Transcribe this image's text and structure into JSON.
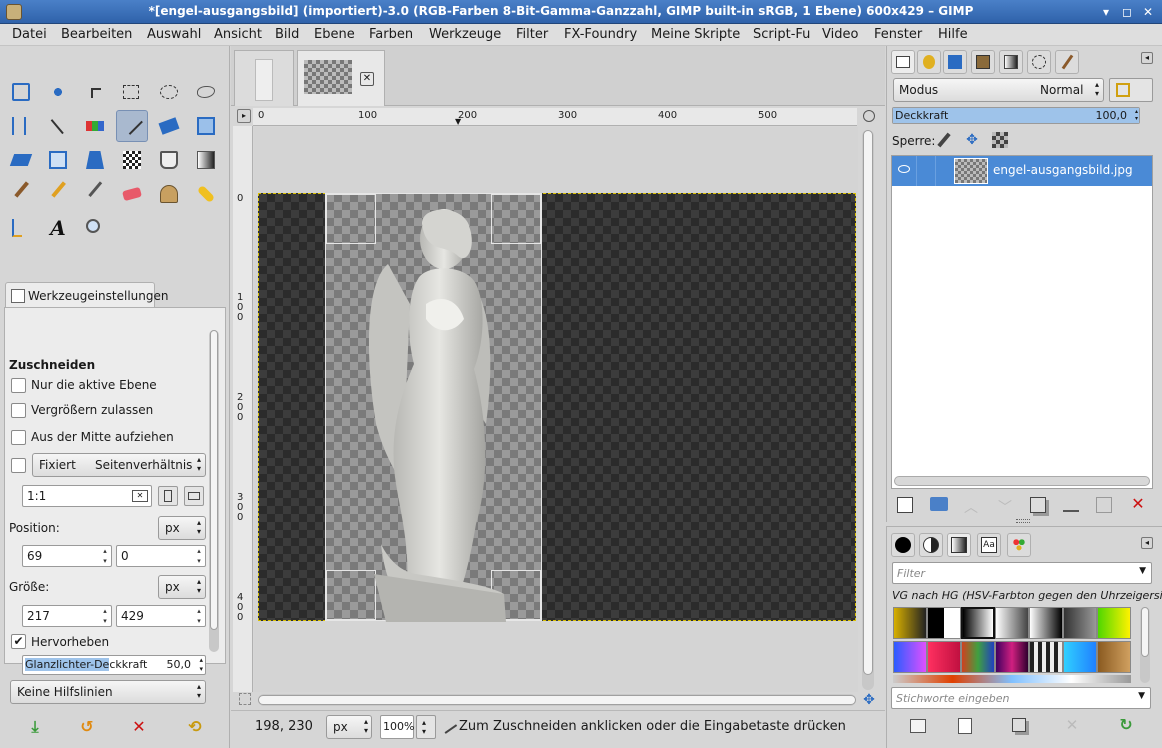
{
  "window": {
    "title": "*[engel-ausgangsbild] (importiert)-3.0 (RGB-Farben 8-Bit-Gamma-Ganzzahl, GIMP built-in sRGB, 1 Ebene) 600x429 – GIMP",
    "minimize": "▾",
    "maximize": "◻",
    "close": "✕"
  },
  "menu": [
    "Datei",
    "Bearbeiten",
    "Auswahl",
    "Ansicht",
    "Bild",
    "Ebene",
    "Farben",
    "Werkzeuge",
    "Filter",
    "FX-Foundry",
    "Meine Skripte",
    "Script-Fu",
    "Video",
    "Fenster",
    "Hilfe"
  ],
  "toolbox": {
    "active_tool": "crop-tool",
    "colors": {
      "foreground": "#000000",
      "background": "#ffffff"
    }
  },
  "tool_options": {
    "tab_label": "Werkzeugeinstellungen",
    "section_title": "Zuschneiden",
    "only_active_layer": "Nur die aktive Ebene",
    "allow_growing": "Vergrößern zulassen",
    "expand_from_center": "Aus der Mitte aufziehen",
    "fixed_label": "Fixiert",
    "fixed_mode": "Seitenverhältnis",
    "ratio_value": "1:1",
    "position_label": "Position:",
    "position_unit": "px",
    "position_x": "69",
    "position_y": "0",
    "size_label": "Größe:",
    "size_unit": "px",
    "size_w": "217",
    "size_h": "429",
    "highlight_label": "Hervorheben",
    "highlight_checked": true,
    "highlight_opacity_label_sel": "Glanzlichter-De",
    "highlight_opacity_label_rest": "ckkraft",
    "highlight_opacity_value": "50,0",
    "guides": "Keine Hilfslinien"
  },
  "rulers": {
    "top": [
      "0",
      "100",
      "200",
      "300",
      "400",
      "500"
    ],
    "left": [
      [
        "0"
      ],
      [
        "1",
        "0",
        "0"
      ],
      [
        "2",
        "0",
        "0"
      ],
      [
        "3",
        "0",
        "0"
      ],
      [
        "4",
        "0",
        "0"
      ]
    ]
  },
  "status": {
    "coords": "198, 230",
    "unit": "px",
    "zoom": "100%",
    "message": "Zum Zuschneiden anklicken oder die Eingabetaste drücken"
  },
  "layers": {
    "mode_label": "Modus",
    "mode_value": "Normal",
    "opacity_label": "Deckkraft",
    "opacity_value": "100,0",
    "opacity_fraction": 1.0,
    "lock_label": "Sperre:",
    "layer_name": "engel-ausgangsbild.jpg"
  },
  "gradients": {
    "filter_placeholder": "Filter",
    "selected_name": "VG nach HG (HSV-Farbton gegen den Uhrzeigersinn)",
    "tags_placeholder": "Stichworte eingeben"
  }
}
